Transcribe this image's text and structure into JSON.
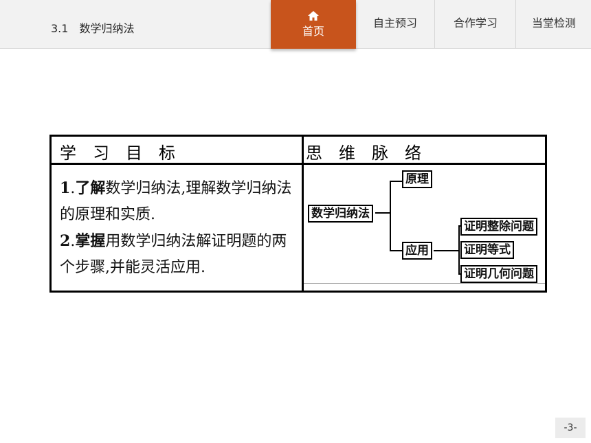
{
  "header": {
    "section_title": "3.1　数学归纳法",
    "tabs": [
      {
        "label": "首页",
        "icon": "home-icon",
        "active": true
      },
      {
        "label": "自主预习"
      },
      {
        "label": "合作学习"
      },
      {
        "label": "当堂检测"
      }
    ],
    "accent_color": "#c8541c"
  },
  "table": {
    "left_header": "学　习　目　标",
    "right_header": "思　维　脉　络",
    "goals": [
      {
        "num": "1",
        "keyword": "了解",
        "text": "数学归纳法,理解数学归纳法的原理和实质."
      },
      {
        "num": "2",
        "keyword": "掌握",
        "text": "用数学归纳法解证明题的两个步骤,并能灵活应用."
      }
    ],
    "mindmap": {
      "root": "数学归纳法",
      "branch1": "原理",
      "branch2": "应用",
      "leaves": [
        "证明整除问题",
        "证明等式",
        "证明几何问题"
      ]
    }
  },
  "page_number": "-3-"
}
